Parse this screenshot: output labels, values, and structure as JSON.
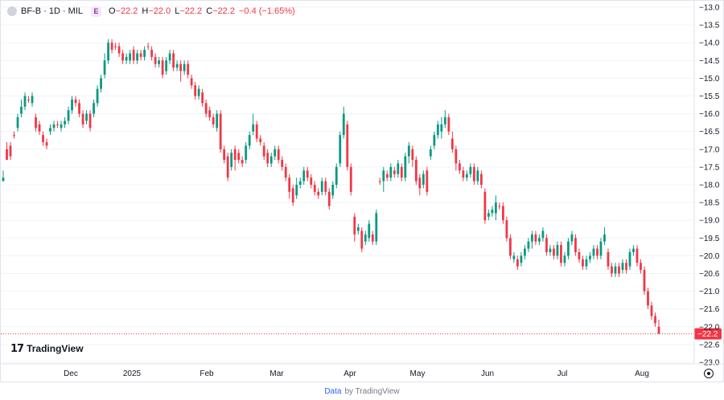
{
  "legend": {
    "symbol": "BF-B · 1D · MIL",
    "badge": "E",
    "o_label": "O",
    "o_value": "−22.2",
    "h_label": "H",
    "h_value": "−22.0",
    "l_label": "L",
    "l_value": "−22.2",
    "c_label": "C",
    "c_value": "−22.2",
    "change": "−0.4 (−1.65%)"
  },
  "branding": {
    "logo_mark": "17",
    "logo_text": "TradingView"
  },
  "footer": {
    "link": "Data",
    "suffix": "by TradingView"
  },
  "colors": {
    "up": "#089981",
    "down": "#f23645",
    "last_price_line": "#f23645",
    "axis_text": "#131722"
  },
  "chart_data": {
    "type": "candlestick",
    "y_axis_side": "right",
    "y_axis_display_sign": "negative",
    "y_ticks": [
      "−13.0",
      "−13.5",
      "−14.0",
      "−14.5",
      "−15.0",
      "−15.5",
      "−16.0",
      "−16.5",
      "−17.0",
      "−17.5",
      "−18.0",
      "−18.5",
      "−19.0",
      "−19.5",
      "−20.0",
      "−20.6",
      "−21.0",
      "−21.6",
      "−22.0",
      "−22.6",
      "−23.0"
    ],
    "x_labels": [
      "Dec",
      "2025",
      "Feb",
      "Mar",
      "Apr",
      "May",
      "Jun",
      "Jul",
      "Aug"
    ],
    "last_price": {
      "value": 22.2,
      "label": "−22.2"
    },
    "candles": [
      [
        17.9,
        17.8,
        17.6,
        17.9
      ],
      [
        17.0,
        17.3,
        17.3,
        16.8
      ],
      [
        16.9,
        17.2,
        17.3,
        16.8
      ],
      [
        16.6,
        16.6,
        16.5,
        16.7
      ],
      [
        16.4,
        16.1,
        16.0,
        16.5
      ],
      [
        16.0,
        15.8,
        15.6,
        16.1
      ],
      [
        15.8,
        15.5,
        15.4,
        15.9
      ],
      [
        15.6,
        15.6,
        15.5,
        15.7
      ],
      [
        15.7,
        15.5,
        15.4,
        15.8
      ],
      [
        16.1,
        16.4,
        16.5,
        16.0
      ],
      [
        16.3,
        16.5,
        16.6,
        16.2
      ],
      [
        16.6,
        16.8,
        16.9,
        16.5
      ],
      [
        16.8,
        16.9,
        17.0,
        16.7
      ],
      [
        16.5,
        16.4,
        16.3,
        16.6
      ],
      [
        16.4,
        16.3,
        16.2,
        16.5
      ],
      [
        16.3,
        16.3,
        16.2,
        16.4
      ],
      [
        16.4,
        16.3,
        16.2,
        16.5
      ],
      [
        16.3,
        16.2,
        16.1,
        16.4
      ],
      [
        16.2,
        15.9,
        15.8,
        16.3
      ],
      [
        15.9,
        15.6,
        15.5,
        16.0
      ],
      [
        15.6,
        15.7,
        15.8,
        15.5
      ],
      [
        15.7,
        16.0,
        16.1,
        15.6
      ],
      [
        16.0,
        16.3,
        16.4,
        15.9
      ],
      [
        16.2,
        16.0,
        15.9,
        16.3
      ],
      [
        16.0,
        16.4,
        16.5,
        15.9
      ],
      [
        16.0,
        15.7,
        15.6,
        16.1
      ],
      [
        15.7,
        15.3,
        15.2,
        15.8
      ],
      [
        15.3,
        15.0,
        14.9,
        15.4
      ],
      [
        14.9,
        14.5,
        14.3,
        15.0
      ],
      [
        14.5,
        14.0,
        13.9,
        14.6
      ],
      [
        14.0,
        14.2,
        14.3,
        13.9
      ],
      [
        14.1,
        14.1,
        14.0,
        14.2
      ],
      [
        14.1,
        14.3,
        14.4,
        14.0
      ],
      [
        14.3,
        14.5,
        14.6,
        14.2
      ],
      [
        14.5,
        14.4,
        14.3,
        14.6
      ],
      [
        14.5,
        14.3,
        14.2,
        14.6
      ],
      [
        14.2,
        14.5,
        14.6,
        14.1
      ],
      [
        14.5,
        14.3,
        14.2,
        14.6
      ],
      [
        14.3,
        14.4,
        14.5,
        14.2
      ],
      [
        14.4,
        14.2,
        14.1,
        14.5
      ],
      [
        14.1,
        14.1,
        14.0,
        14.2
      ],
      [
        14.2,
        14.4,
        14.5,
        14.1
      ],
      [
        14.4,
        14.6,
        14.7,
        14.3
      ],
      [
        14.6,
        14.5,
        14.4,
        14.7
      ],
      [
        14.5,
        14.9,
        15.0,
        14.4
      ],
      [
        14.8,
        14.5,
        14.4,
        14.9
      ],
      [
        14.5,
        14.3,
        14.2,
        14.6
      ],
      [
        14.3,
        14.7,
        14.8,
        14.2
      ],
      [
        14.7,
        14.6,
        14.5,
        14.8
      ],
      [
        14.6,
        14.8,
        15.1,
        14.5
      ],
      [
        14.8,
        14.6,
        14.5,
        14.9
      ],
      [
        14.6,
        14.9,
        15.0,
        14.5
      ],
      [
        15.0,
        15.2,
        15.3,
        14.9
      ],
      [
        15.2,
        15.5,
        15.6,
        15.1
      ],
      [
        15.5,
        15.3,
        15.2,
        15.6
      ],
      [
        15.4,
        15.7,
        15.8,
        15.3
      ],
      [
        15.7,
        16.0,
        16.1,
        15.6
      ],
      [
        15.9,
        16.1,
        16.2,
        15.8
      ],
      [
        16.1,
        16.3,
        16.4,
        16.0
      ],
      [
        16.4,
        16.0,
        15.9,
        16.5
      ],
      [
        16.0,
        17.0,
        17.1,
        15.9
      ],
      [
        17.0,
        17.3,
        17.4,
        16.9
      ],
      [
        17.2,
        17.8,
        17.9,
        17.1
      ],
      [
        17.5,
        17.1,
        17.0,
        17.6
      ],
      [
        17.0,
        17.3,
        17.6,
        16.9
      ],
      [
        17.1,
        17.3,
        17.4,
        17.0
      ],
      [
        17.3,
        17.4,
        17.5,
        17.2
      ],
      [
        17.3,
        16.9,
        16.8,
        17.4
      ],
      [
        16.9,
        16.6,
        16.5,
        17.0
      ],
      [
        16.5,
        16.3,
        16.0,
        16.6
      ],
      [
        16.3,
        16.7,
        16.8,
        16.2
      ],
      [
        16.7,
        16.8,
        16.9,
        16.6
      ],
      [
        16.9,
        17.2,
        17.3,
        16.8
      ],
      [
        17.1,
        17.4,
        17.5,
        17.0
      ],
      [
        17.4,
        17.2,
        17.1,
        17.5
      ],
      [
        17.2,
        17.0,
        16.9,
        17.3
      ],
      [
        17.0,
        17.3,
        17.4,
        16.9
      ],
      [
        17.3,
        17.5,
        17.6,
        17.2
      ],
      [
        17.5,
        17.8,
        17.9,
        17.4
      ],
      [
        17.8,
        18.2,
        18.4,
        17.7
      ],
      [
        18.1,
        18.5,
        18.6,
        18.0
      ],
      [
        18.3,
        18.0,
        17.8,
        18.4
      ],
      [
        18.0,
        17.9,
        17.8,
        18.1
      ],
      [
        17.9,
        17.6,
        17.5,
        18.0
      ],
      [
        17.6,
        17.8,
        17.9,
        17.5
      ],
      [
        17.8,
        18.0,
        18.1,
        17.7
      ],
      [
        18.0,
        18.2,
        18.3,
        17.9
      ],
      [
        18.2,
        18.3,
        18.4,
        18.1
      ],
      [
        18.2,
        17.9,
        17.8,
        18.3
      ],
      [
        17.9,
        18.2,
        18.3,
        17.8
      ],
      [
        18.2,
        18.6,
        18.7,
        18.1
      ],
      [
        18.3,
        18.0,
        17.9,
        18.4
      ],
      [
        18.0,
        17.5,
        17.4,
        18.1
      ],
      [
        17.4,
        16.6,
        16.5,
        17.5
      ],
      [
        16.6,
        16.0,
        15.8,
        16.7
      ],
      [
        16.3,
        17.5,
        17.6,
        16.2
      ],
      [
        17.5,
        18.2,
        18.3,
        17.4
      ],
      [
        18.9,
        19.4,
        19.6,
        18.8
      ],
      [
        19.3,
        19.2,
        19.1,
        19.4
      ],
      [
        19.3,
        19.8,
        19.9,
        19.2
      ],
      [
        19.6,
        19.4,
        19.3,
        19.7
      ],
      [
        19.5,
        19.1,
        19.0,
        19.6
      ],
      [
        19.4,
        19.6,
        19.7,
        19.3
      ],
      [
        19.6,
        18.8,
        18.7,
        19.7
      ],
      [
        17.9,
        17.9,
        17.8,
        18.0
      ],
      [
        17.9,
        17.6,
        17.5,
        18.2
      ],
      [
        17.7,
        17.8,
        17.9,
        17.6
      ],
      [
        17.8,
        17.5,
        17.4,
        17.9
      ],
      [
        17.6,
        17.7,
        17.8,
        17.5
      ],
      [
        17.7,
        17.4,
        17.3,
        17.8
      ],
      [
        17.5,
        17.8,
        17.9,
        17.4
      ],
      [
        17.8,
        17.2,
        17.1,
        17.9
      ],
      [
        17.2,
        16.9,
        16.8,
        17.4
      ],
      [
        17.0,
        17.3,
        17.5,
        16.9
      ],
      [
        17.3,
        17.9,
        18.0,
        17.2
      ],
      [
        17.8,
        18.1,
        18.3,
        17.7
      ],
      [
        18.0,
        17.7,
        17.6,
        18.1
      ],
      [
        17.6,
        18.2,
        18.3,
        17.5
      ],
      [
        17.2,
        17.0,
        16.9,
        17.3
      ],
      [
        16.9,
        16.6,
        16.5,
        17.0
      ],
      [
        16.6,
        16.3,
        16.2,
        16.7
      ],
      [
        16.5,
        16.3,
        16.1,
        16.7
      ],
      [
        16.3,
        16.1,
        15.9,
        16.4
      ],
      [
        16.1,
        16.5,
        16.6,
        16.0
      ],
      [
        16.7,
        17.0,
        17.1,
        16.5
      ],
      [
        17.0,
        17.4,
        17.6,
        16.9
      ],
      [
        17.4,
        17.6,
        17.7,
        17.3
      ],
      [
        17.6,
        17.8,
        17.9,
        17.5
      ],
      [
        17.8,
        17.7,
        17.6,
        17.9
      ],
      [
        17.7,
        17.5,
        17.4,
        17.8
      ],
      [
        17.5,
        17.9,
        18.0,
        17.4
      ],
      [
        17.9,
        17.6,
        17.5,
        18.0
      ],
      [
        17.7,
        18.0,
        18.1,
        17.6
      ],
      [
        18.2,
        19.0,
        19.1,
        18.1
      ],
      [
        18.9,
        18.8,
        18.7,
        19.0
      ],
      [
        18.8,
        18.7,
        18.6,
        18.9
      ],
      [
        18.8,
        18.5,
        18.3,
        19.0
      ],
      [
        18.6,
        18.6,
        18.5,
        18.7
      ],
      [
        18.6,
        19.0,
        19.1,
        18.5
      ],
      [
        19.0,
        19.5,
        19.6,
        18.9
      ],
      [
        19.5,
        20.0,
        20.1,
        19.4
      ],
      [
        20.1,
        20.0,
        19.9,
        20.2
      ],
      [
        20.1,
        20.3,
        20.4,
        20.0
      ],
      [
        20.2,
        20.0,
        19.9,
        20.3
      ],
      [
        20.0,
        19.8,
        19.7,
        20.1
      ],
      [
        19.8,
        19.6,
        19.5,
        19.9
      ],
      [
        19.6,
        19.4,
        19.3,
        19.8
      ],
      [
        19.4,
        19.6,
        19.7,
        19.3
      ],
      [
        19.6,
        19.5,
        19.4,
        19.7
      ],
      [
        19.5,
        19.3,
        19.2,
        19.6
      ],
      [
        19.5,
        19.9,
        20.0,
        19.4
      ],
      [
        19.9,
        19.8,
        19.7,
        20.0
      ],
      [
        19.8,
        20.0,
        20.1,
        19.7
      ],
      [
        20.0,
        19.7,
        19.6,
        20.1
      ],
      [
        19.7,
        20.2,
        20.3,
        19.6
      ],
      [
        20.2,
        20.0,
        19.9,
        20.3
      ],
      [
        20.0,
        19.6,
        19.5,
        20.1
      ],
      [
        19.6,
        19.4,
        19.3,
        19.7
      ],
      [
        19.5,
        19.9,
        20.0,
        19.4
      ],
      [
        19.9,
        20.1,
        20.2,
        19.8
      ],
      [
        20.1,
        20.3,
        20.4,
        20.0
      ],
      [
        20.3,
        20.1,
        20.0,
        20.4
      ],
      [
        20.1,
        20.0,
        19.9,
        20.2
      ],
      [
        20.0,
        19.8,
        19.7,
        20.1
      ],
      [
        19.8,
        20.0,
        20.1,
        19.7
      ],
      [
        20.0,
        19.6,
        19.5,
        20.1
      ],
      [
        19.6,
        19.4,
        19.2,
        19.7
      ],
      [
        19.9,
        20.3,
        20.4,
        19.8
      ],
      [
        20.3,
        20.5,
        20.6,
        20.2
      ],
      [
        20.5,
        20.3,
        20.2,
        20.6
      ],
      [
        20.3,
        20.5,
        20.6,
        20.2
      ],
      [
        20.4,
        20.2,
        20.1,
        20.5
      ],
      [
        20.2,
        20.4,
        20.5,
        20.1
      ],
      [
        20.3,
        19.9,
        19.8,
        20.4
      ],
      [
        19.9,
        19.8,
        19.7,
        20.0
      ],
      [
        19.8,
        20.2,
        20.3,
        19.7
      ],
      [
        20.2,
        20.4,
        20.5,
        20.1
      ],
      [
        20.4,
        21.0,
        21.1,
        20.3
      ],
      [
        21.0,
        21.4,
        21.5,
        20.9
      ],
      [
        21.4,
        21.7,
        21.8,
        21.3
      ],
      [
        21.7,
        21.9,
        22.0,
        21.6
      ],
      [
        22.0,
        22.2,
        22.2,
        21.8
      ]
    ]
  }
}
